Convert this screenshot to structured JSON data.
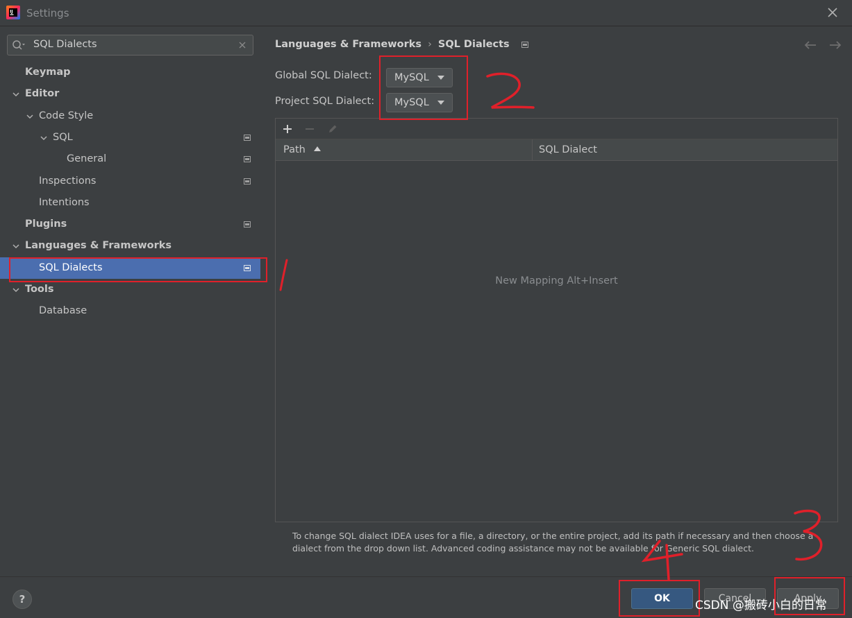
{
  "window": {
    "title": "Settings"
  },
  "search": {
    "value": "SQL Dialects"
  },
  "tree": [
    {
      "label": "Keymap",
      "bold": true,
      "level": 0,
      "chevron": "none",
      "project": false
    },
    {
      "label": "Editor",
      "bold": true,
      "level": 0,
      "chevron": "down",
      "project": false
    },
    {
      "label": "Code Style",
      "bold": false,
      "level": 1,
      "chevron": "down",
      "project": false
    },
    {
      "label": "SQL",
      "bold": false,
      "level": 2,
      "chevron": "down",
      "project": true
    },
    {
      "label": "General",
      "bold": false,
      "level": 3,
      "chevron": "none",
      "project": true
    },
    {
      "label": "Inspections",
      "bold": false,
      "level": 1,
      "chevron": "none",
      "project": true
    },
    {
      "label": "Intentions",
      "bold": false,
      "level": 1,
      "chevron": "none",
      "project": false
    },
    {
      "label": "Plugins",
      "bold": true,
      "level": 0,
      "chevron": "none",
      "project": true
    },
    {
      "label": "Languages & Frameworks",
      "bold": true,
      "level": 0,
      "chevron": "down",
      "project": false
    },
    {
      "label": "SQL Dialects",
      "bold": false,
      "level": 1,
      "chevron": "none",
      "project": true,
      "selected": true
    },
    {
      "label": "Tools",
      "bold": true,
      "level": 0,
      "chevron": "down",
      "project": false
    },
    {
      "label": "Database",
      "bold": false,
      "level": 1,
      "chevron": "none",
      "project": false
    }
  ],
  "breadcrumb": {
    "parent": "Languages & Frameworks",
    "separator": "›",
    "current": "SQL Dialects"
  },
  "form": {
    "global_label": "Global SQL Dialect:",
    "global_value": "MySQL",
    "project_label": "Project SQL Dialect:",
    "project_value": "MySQL"
  },
  "toolbar": {
    "add": "add-icon",
    "remove": "remove-icon",
    "edit": "edit-icon"
  },
  "table": {
    "columns": [
      "Path",
      "SQL Dialect"
    ],
    "empty_text": "New Mapping Alt+Insert"
  },
  "help_text": "To change SQL dialect IDEA uses for a file, a directory, or the entire project, add its path if necessary and then choose a dialect from the drop down list. Advanced coding assistance may not be available for Generic SQL dialect.",
  "buttons": {
    "help": "?",
    "ok": "OK",
    "cancel": "Cancel",
    "apply": "Apply"
  },
  "annotations": {
    "marks": [
      "1",
      "2",
      "3",
      "4"
    ],
    "color": "#e0202a"
  },
  "watermark": "CSDN @搬砖小白的日常",
  "colors": {
    "selection": "#4b6eaf",
    "ok_button": "#365880",
    "background": "#3c3f41"
  }
}
